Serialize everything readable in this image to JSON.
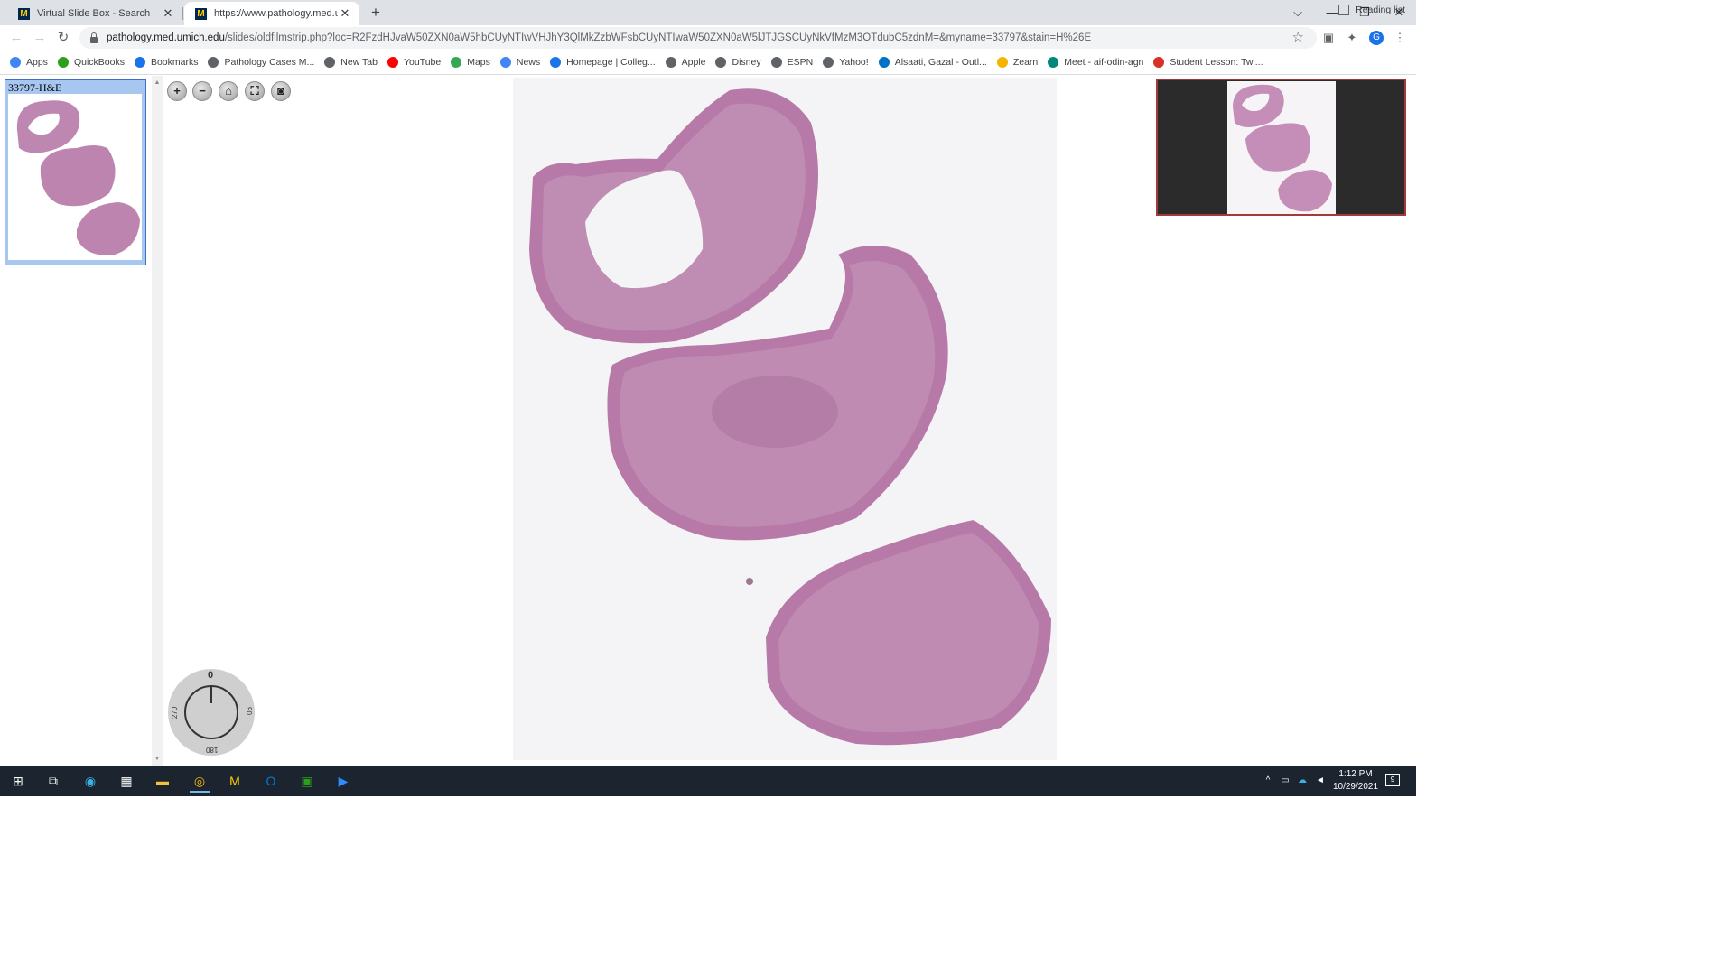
{
  "browser": {
    "tabs": [
      {
        "title": "Virtual Slide Box - Search",
        "favicon": "M"
      },
      {
        "title": "https://www.pathology.med.um",
        "favicon": "M"
      }
    ],
    "url_host": "pathology.med.umich.edu",
    "url_path": "/slides/oldfilmstrip.php?loc=R2FzdHJvaW50ZXN0aW5hbCUyNTIwVHJhY3QlMkZzbWFsbCUyNTIwaW50ZXN0aW5lJTJGSCUyNkVfMzM3OTdubC5zdnM=&myname=33797&stain=H%26E",
    "profile_initial": "G",
    "window_controls": {
      "tab_search": "⌵",
      "minimize": "—",
      "restore": "❐",
      "close": "✕"
    }
  },
  "bookmarks": [
    {
      "label": "Apps",
      "icon": "apps-grid-icon",
      "color": "#4285f4"
    },
    {
      "label": "QuickBooks",
      "icon": "quickbooks-icon",
      "color": "#2ca01c"
    },
    {
      "label": "Bookmarks",
      "icon": "star-icon",
      "color": "#1a73e8"
    },
    {
      "label": "Pathology Cases M...",
      "icon": "globe-icon",
      "color": "#5f6368"
    },
    {
      "label": "New Tab",
      "icon": "globe-icon",
      "color": "#5f6368"
    },
    {
      "label": "YouTube",
      "icon": "youtube-icon",
      "color": "#ff0000"
    },
    {
      "label": "Maps",
      "icon": "maps-pin-icon",
      "color": "#34a853"
    },
    {
      "label": "News",
      "icon": "news-icon",
      "color": "#4285f4"
    },
    {
      "label": "Homepage | Colleg...",
      "icon": "college-icon",
      "color": "#1a73e8"
    },
    {
      "label": "Apple",
      "icon": "apple-icon",
      "color": "#5f6368"
    },
    {
      "label": "Disney",
      "icon": "disney-icon",
      "color": "#5f6368"
    },
    {
      "label": "ESPN",
      "icon": "globe-icon",
      "color": "#5f6368"
    },
    {
      "label": "Yahoo!",
      "icon": "globe-icon",
      "color": "#5f6368"
    },
    {
      "label": "Alsaati, Gazal - Outl...",
      "icon": "outlook-icon",
      "color": "#0072c6"
    },
    {
      "label": "Zearn",
      "icon": "zearn-icon",
      "color": "#f4b400"
    },
    {
      "label": "Meet - aif-odin-agn",
      "icon": "meet-icon",
      "color": "#00897b"
    },
    {
      "label": "Student Lesson: Twi...",
      "icon": "lesson-icon",
      "color": "#d93025"
    }
  ],
  "reading_list": "Reading list",
  "filmstrip": {
    "slide_label": "33797-H&E"
  },
  "viewer": {
    "buttons": [
      {
        "name": "zoom-in-button",
        "glyph": "+"
      },
      {
        "name": "zoom-out-button",
        "glyph": "−"
      },
      {
        "name": "home-button",
        "glyph": "⌂"
      },
      {
        "name": "fullscreen-button",
        "glyph": "⛶"
      },
      {
        "name": "screenshot-button",
        "glyph": "◙"
      }
    ],
    "rotation": {
      "top": "0",
      "right": "90",
      "bottom": "180",
      "left": "270"
    },
    "tissue_color": "#b77aa8"
  },
  "taskbar": {
    "time": "1:12 PM",
    "date": "10/29/2021",
    "notifications": "9"
  }
}
